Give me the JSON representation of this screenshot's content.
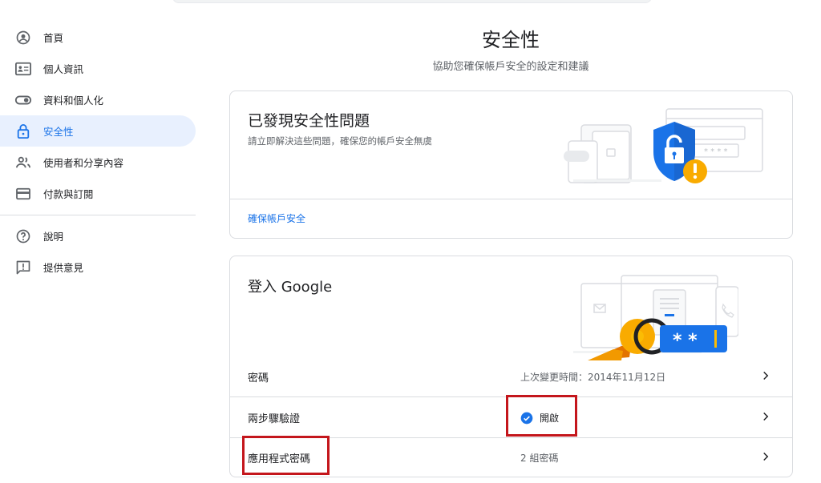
{
  "sidebar": {
    "items": [
      {
        "label": "首頁",
        "icon": "account-circle-icon"
      },
      {
        "label": "個人資訊",
        "icon": "id-card-icon"
      },
      {
        "label": "資料和個人化",
        "icon": "toggle-icon"
      },
      {
        "label": "安全性",
        "icon": "lock-icon",
        "active": true
      },
      {
        "label": "使用者和分享內容",
        "icon": "people-icon"
      },
      {
        "label": "付款與訂閱",
        "icon": "credit-card-icon"
      }
    ],
    "secondary": [
      {
        "label": "說明",
        "icon": "help-icon"
      },
      {
        "label": "提供意見",
        "icon": "feedback-icon"
      }
    ]
  },
  "header": {
    "title": "安全性",
    "subtitle": "協助您確保帳戶安全的設定和建議"
  },
  "issues_card": {
    "title": "已發現安全性問題",
    "description": "請立即解決這些問題，確保您的帳戶安全無虞",
    "link": "確保帳戶安全"
  },
  "signin_card": {
    "title": "登入 Google",
    "rows": [
      {
        "label": "密碼",
        "value": "上次變更時間：2014年11月12日"
      },
      {
        "label": "兩步驟驗證",
        "value": "開啟"
      },
      {
        "label": "應用程式密碼",
        "value": "2 組密碼"
      }
    ]
  },
  "colors": {
    "accent": "#1a73e8",
    "active_bg": "#e8f0fe",
    "highlight": "#c4161c",
    "warning": "#f9ab00"
  }
}
